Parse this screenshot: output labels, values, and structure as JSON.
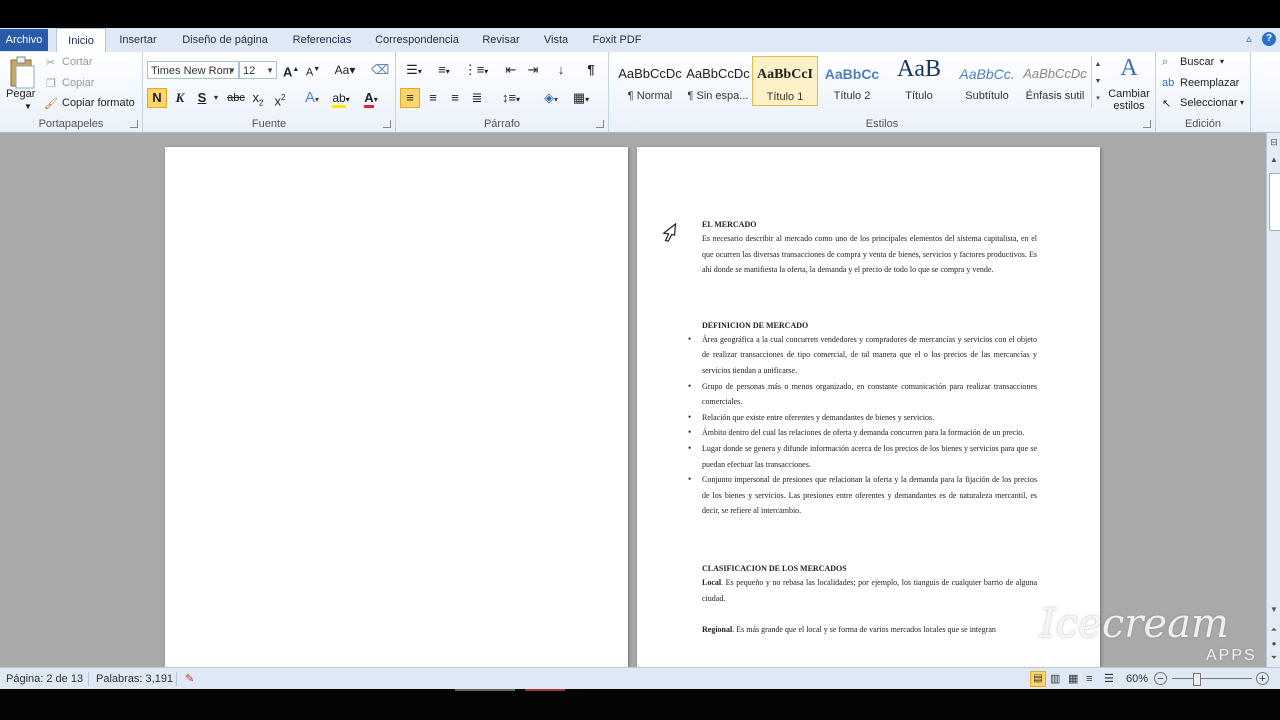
{
  "tabs": {
    "file": "Archivo",
    "items": [
      "Inicio",
      "Insertar",
      "Diseño de página",
      "Referencias",
      "Correspondencia",
      "Revisar",
      "Vista",
      "Foxit PDF"
    ]
  },
  "clipboard": {
    "paste": "Pegar",
    "cut": "Cortar",
    "copy": "Copiar",
    "format_painter": "Copiar formato",
    "label": "Portapapeles"
  },
  "font": {
    "family": "Times New Rom",
    "size": "12",
    "label": "Fuente",
    "bold": "N",
    "italic": "K",
    "underline": "S",
    "strike": "abc"
  },
  "paragraph": {
    "label": "Párrafo"
  },
  "styles": {
    "label": "Estilos",
    "items": [
      {
        "sample": "AaBbCcDc",
        "name": "¶ Normal"
      },
      {
        "sample": "AaBbCcDc",
        "name": "¶ Sin espa..."
      },
      {
        "sample": "AaBbCcI",
        "name": "Título 1"
      },
      {
        "sample": "AaBbCc",
        "name": "Título 2"
      },
      {
        "sample": "AaB",
        "name": "Título"
      },
      {
        "sample": "AaBbCc.",
        "name": "Subtítulo"
      },
      {
        "sample": "AaBbCcDc",
        "name": "Énfasis sutil"
      }
    ],
    "change_styles": "Cambiar estilos"
  },
  "editing": {
    "label": "Edición",
    "find": "Buscar",
    "replace": "Reemplazar",
    "select": "Seleccionar"
  },
  "document": {
    "heading1": "EL MERCADO",
    "para1": "Es necesario describir al mercado como uno de los principales elementos del sistema capitalista, en el que ocurren las diversas transacciones de compra y venta de bienes, servicios y factores productivos. Es ahí donde se manifiesta la oferta, la demanda y el precio de todo lo que se compra y vende.",
    "heading2": "DEFINICION DE MERCADO",
    "bullets": [
      "Área geográfica a la cual concurren vendedores y compradores de mercancías y servicios con el objeto de realizar transacciones de tipo comercial, de tal manera que el o los precios de las mercancías y servicios tiendan a unificarse.",
      "Grupo de personas más o menos organizado, en constante comunicación para realizar transacciones comerciales.",
      "Relación que existe entre oferentes y demandantes de bienes y servicios.",
      "Ámbito dentro del cual las relaciones de oferta y demanda concurren para la formación de un precio.",
      "Lugar donde se genera y difunde información acerca de los precios de los bienes y servicios para que se puedan efectuar las transacciones.",
      "Conjunto impersonal de presiones que relacionan la oferta y la demanda para la fijación de los precios de los bienes y servicios. Las presiones entre oferentes y demandantes es de naturaleza mercantil, es decir, se refiere al intercambio."
    ],
    "heading3": "CLASIFICACION DE LOS MERCADOS",
    "local_label": "Local",
    "local_text": ". Es pequeño y no rebasa las localidades; por ejemplo, los tianguis de cualquier barrio de alguna ciudad.",
    "regional_label": "Regional",
    "regional_text": ". Es más grande que el local y se forma de varios mercados locales que se integran"
  },
  "status": {
    "page": "Página: 2 de 13",
    "words": "Palabras: 3,191",
    "zoom": "60%"
  },
  "watermark": {
    "text": "Icecream",
    "sub": "APPS"
  }
}
